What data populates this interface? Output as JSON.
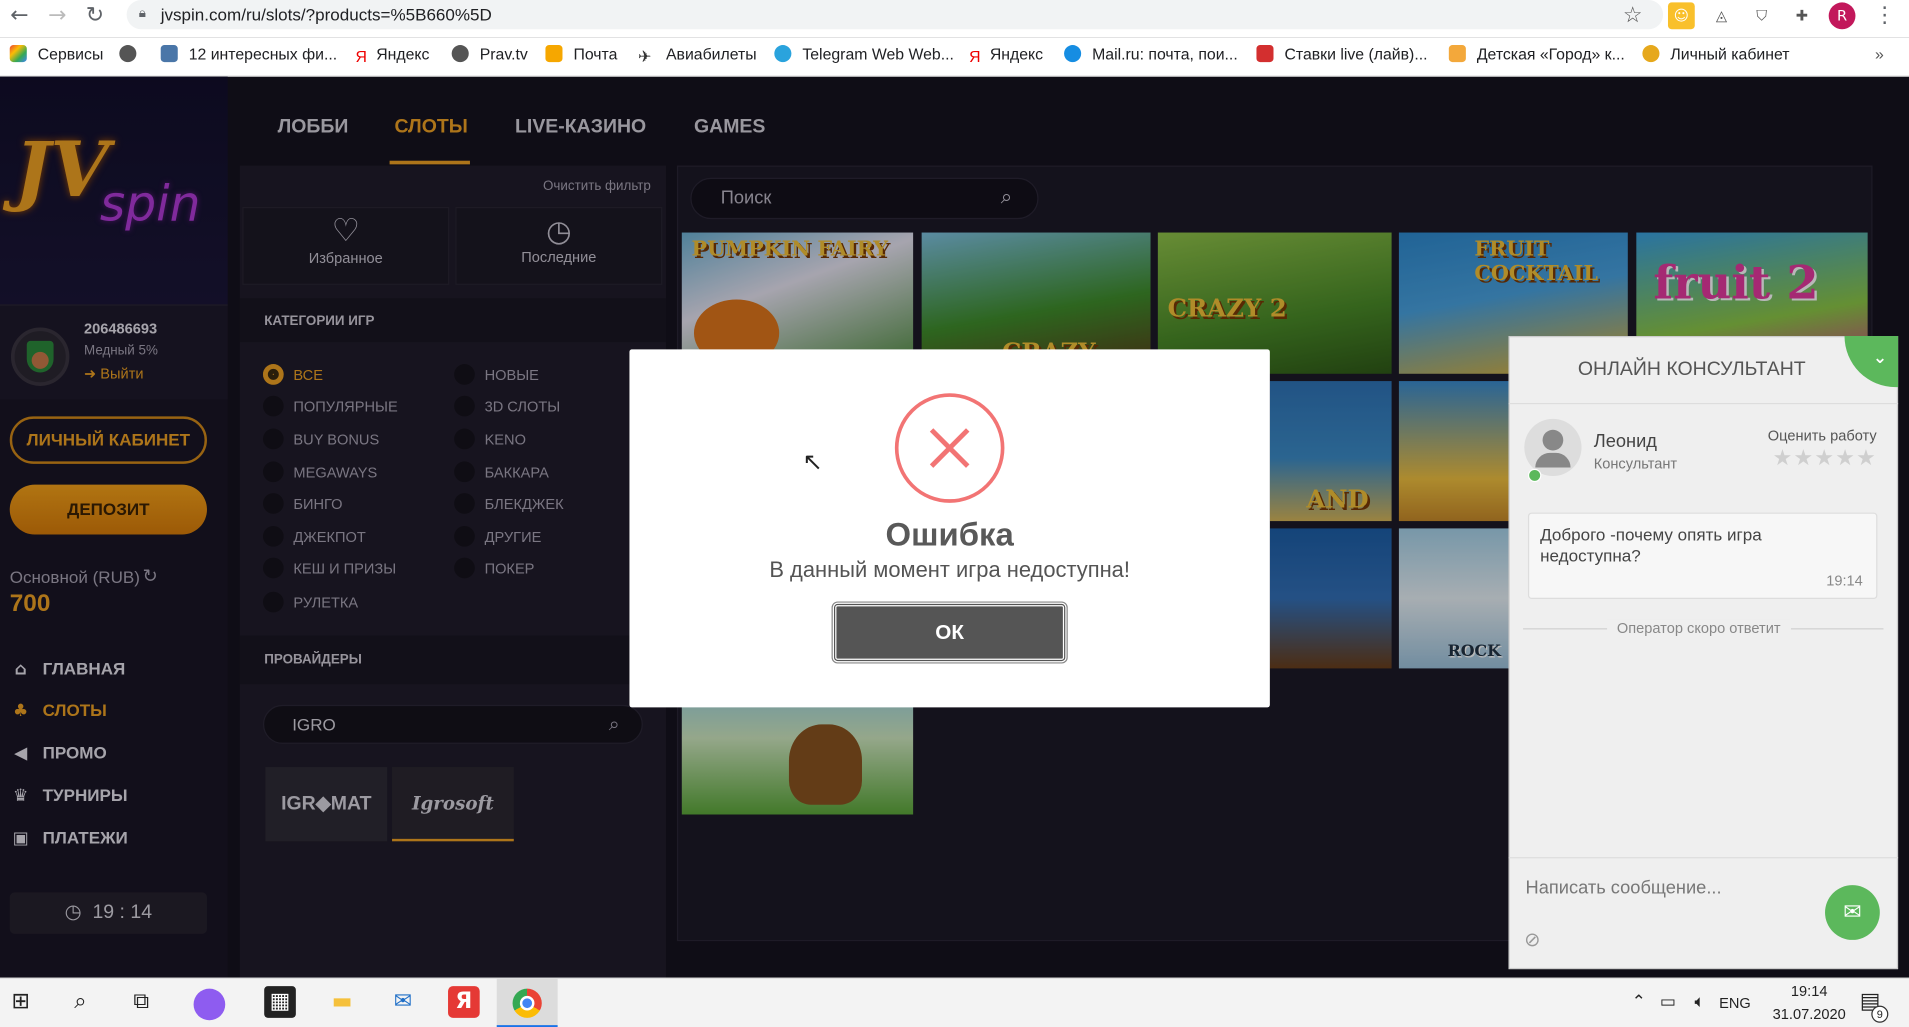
{
  "browser": {
    "url": "jvspin.com/ru/slots/?products=%5B660%5D",
    "profile_initial": "R",
    "bookmarks": [
      "Сервисы",
      "12 интересных фи...",
      "Яндекс",
      "Prav.tv",
      "Почта",
      "Авиабилеты",
      "Telegram Web Web...",
      "Яндекс",
      "Mail.ru: почта, пои...",
      "Ставки live (лайв)...",
      "Детская «Город» к...",
      "Личный кабинет"
    ]
  },
  "logo": {
    "text1": "JV",
    "text2": "spin"
  },
  "user": {
    "id": "206486693",
    "level": "Медный 5%",
    "logout": "Выйти",
    "cabinet_label": "ЛИЧНЫЙ КАБИНЕТ",
    "deposit_label": "ДЕПОЗИТ",
    "balance_label": "Основной (RUB)",
    "balance": "700"
  },
  "side_menu": [
    "ГЛАВНАЯ",
    "СЛОТЫ",
    "ПРОМО",
    "ТУРНИРЫ",
    "ПЛАТЕЖИ"
  ],
  "clock": {
    "h": "19",
    "sep": ":",
    "m": "14"
  },
  "tabs": [
    "ЛОББИ",
    "СЛОТЫ",
    "LIVE-КАЗИНО",
    "GAMES"
  ],
  "filters": {
    "clear": "Очистить фильтр",
    "favorites": "Избранное",
    "recent": "Последние",
    "categories_title": "КАТЕГОРИИ ИГР",
    "col1": [
      "ВСЕ",
      "ПОПУЛЯРНЫЕ",
      "BUY BONUS",
      "MEGAWAYS",
      "БИНГО",
      "ДЖЕКПОТ",
      "КЕШ И ПРИЗЫ",
      "РУЛЕТКА"
    ],
    "col2": [
      "НОВЫЕ",
      "3D СЛОТЫ",
      "KENO",
      "БАККАРА",
      "БЛЕКДЖЕК",
      "ДРУГИЕ",
      "ПОКЕР"
    ],
    "providers_title": "ПРОВАЙДЕРЫ",
    "provider_search": "IGRO",
    "provider_1": "IGR◆MAT",
    "provider_2": "Igrosoft"
  },
  "search": {
    "placeholder": "Поиск"
  },
  "tiles": [
    "PUMPKIN FAIRY",
    "CRAZY",
    "CRAZY 2",
    "FRUIT COCKTAIL",
    "fruit 2",
    "AND",
    "",
    "ROCK"
  ],
  "modal": {
    "title": "Ошибка",
    "text": "В данный момент игра недоступна!",
    "ok": "ОК"
  },
  "chat": {
    "title": "ОНЛАЙН КОНСУЛЬТАНТ",
    "agent_name": "Леонид",
    "agent_role": "Консультант",
    "rate": "Оценить работу",
    "message": "Доброго -почему опять игра недоступна?",
    "message_time": "19:14",
    "status": "Оператор скоро ответит",
    "input_placeholder": "Написать сообщение..."
  },
  "taskbar": {
    "lang": "ENG",
    "time": "19:14",
    "date": "31.07.2020",
    "notif_count": "9"
  },
  "colors": {
    "accent": "#f0a225",
    "error": "#f27474",
    "chat_green": "#5cb85c"
  }
}
